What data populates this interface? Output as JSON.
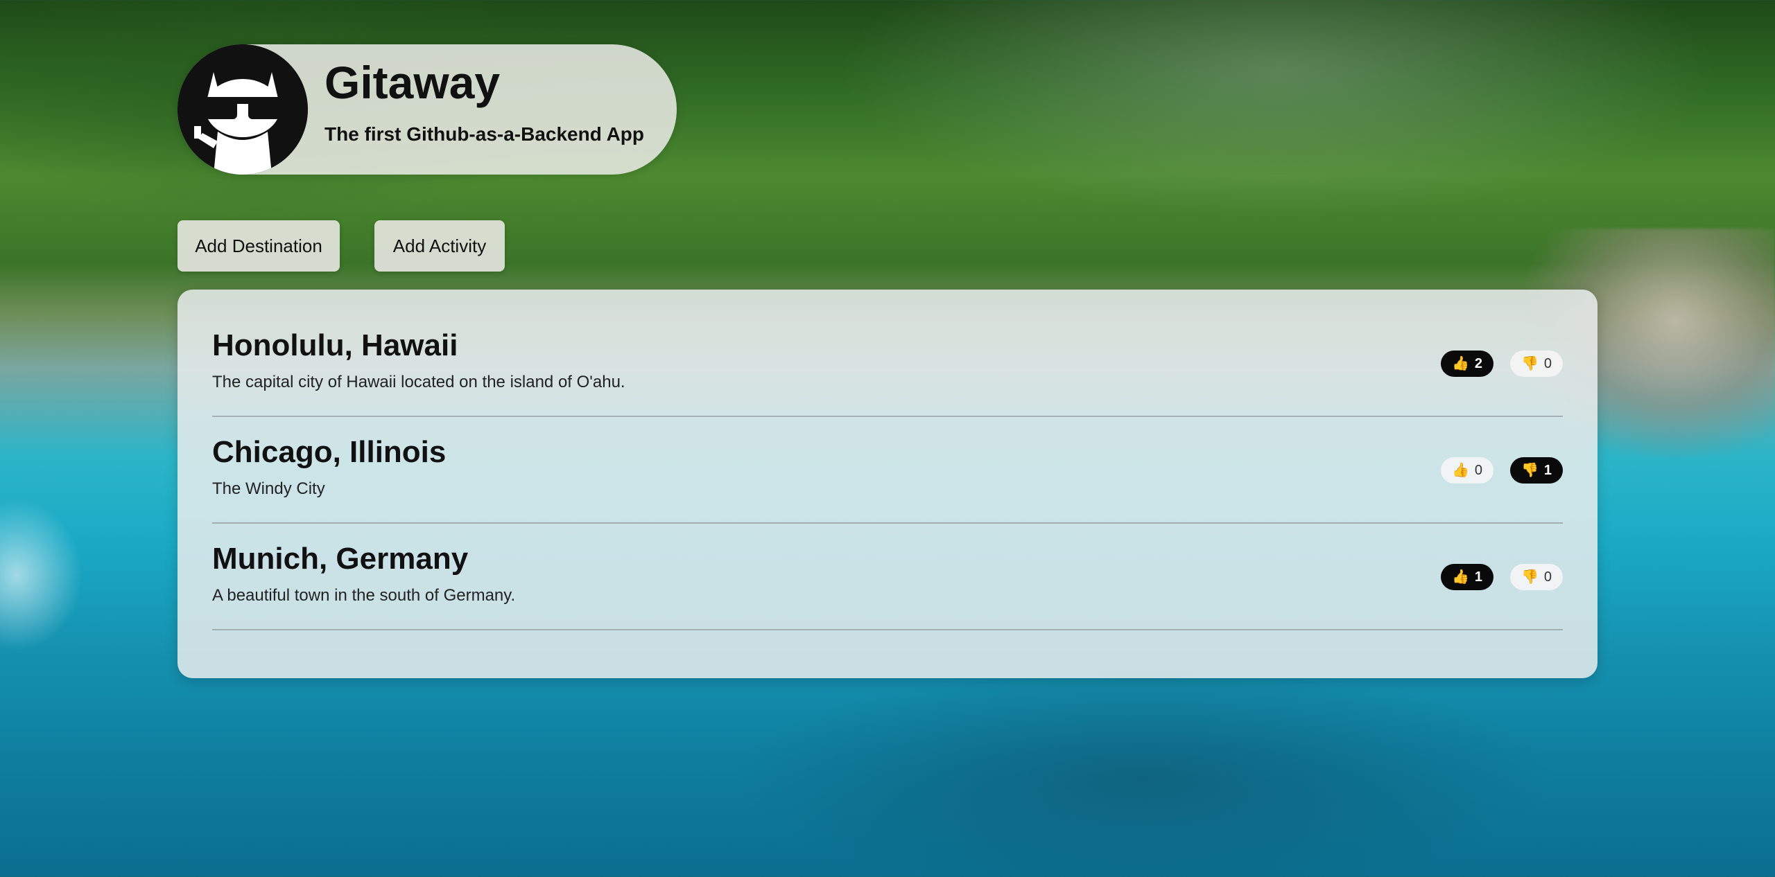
{
  "app": {
    "title": "Gitaway",
    "subtitle": "The first Github-as-a-Backend App",
    "logo_icon": "octocat-sunglasses-icon"
  },
  "actions": {
    "add_destination": "Add Destination",
    "add_activity": "Add Activity"
  },
  "destinations": [
    {
      "title": "Honolulu, Hawaii",
      "description": "The capital city of Hawaii located on the island of O'ahu.",
      "upvotes": "2",
      "downvotes": "0",
      "upvote_active": true,
      "downvote_active": false
    },
    {
      "title": "Chicago, Illinois",
      "description": "The Windy City",
      "upvotes": "0",
      "downvotes": "1",
      "upvote_active": false,
      "downvote_active": true
    },
    {
      "title": "Munich, Germany",
      "description": "A beautiful town in the south of Germany.",
      "upvotes": "1",
      "downvotes": "0",
      "upvote_active": true,
      "downvote_active": false
    }
  ],
  "icons": {
    "upvote": "thumbs-up-icon",
    "downvote": "thumbs-down-icon"
  },
  "colors": {
    "active_vote_bg": "#0a0a0a",
    "inactive_vote_bg": "#f5f5f5",
    "thumb_color": "#f2b705"
  }
}
